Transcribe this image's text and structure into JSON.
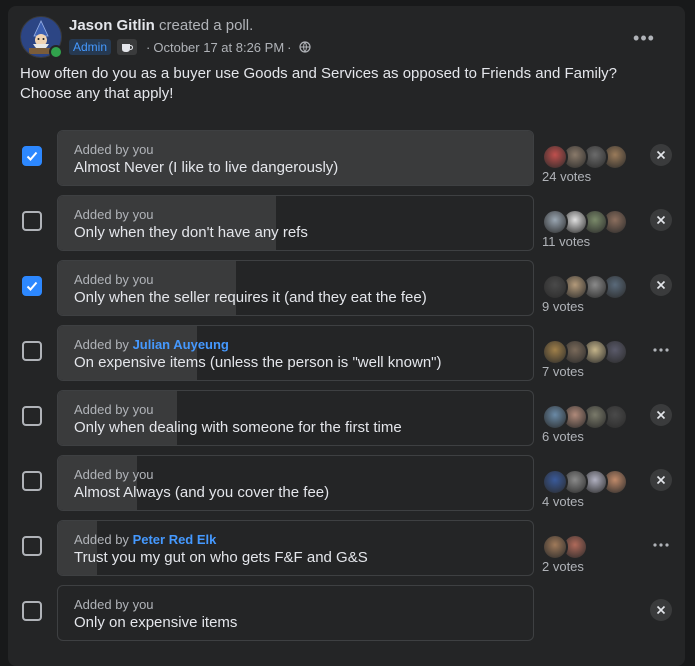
{
  "post": {
    "author": "Jason Gitlin",
    "action": "created a poll.",
    "admin_badge": "Admin",
    "timestamp": "October 17 at 8:26 PM",
    "separator": "·",
    "more_label": "•••",
    "question": "How often do you as a buyer use Goods and Services as opposed to Friends and Family?  Choose any that apply!"
  },
  "colors": {
    "accent": "#2d88ff",
    "link": "#4599ff",
    "card_bg": "#242526",
    "fill": "#3a3b3c"
  },
  "options": [
    {
      "checked": true,
      "added_prefix": "Added by",
      "added_by": "you",
      "text": "Almost Never (I like to live dangerously)",
      "votes": "24 votes",
      "vote_share": 1.0,
      "action": "close-icon",
      "voter_colors": [
        "#c0504d",
        "#8a7a6a",
        "#6b6b6b",
        "#9a7b5a"
      ]
    },
    {
      "checked": false,
      "added_prefix": "Added by",
      "added_by": "you",
      "text": "Only when they don't have any refs",
      "votes": "11 votes",
      "vote_share": 0.458,
      "action": "close-icon",
      "voter_colors": [
        "#9aa6b2",
        "#e0e0e0",
        "#7a8a6a",
        "#8c6f5e"
      ]
    },
    {
      "checked": true,
      "added_prefix": "Added by",
      "added_by": "you",
      "text": "Only when the seller requires it (and they eat the fee)",
      "votes": "9 votes",
      "vote_share": 0.375,
      "action": "close-icon",
      "voter_colors": [
        "#4a4a4a",
        "#b39a7a",
        "#8a8a8a",
        "#5a6a7a"
      ]
    },
    {
      "checked": false,
      "added_prefix": "Added by",
      "added_by": "Julian Auyeung",
      "text": "On expensive items (unless the person is \"well known\")",
      "votes": "7 votes",
      "vote_share": 0.292,
      "action": "more-icon",
      "voter_colors": [
        "#a0804a",
        "#7a6a5a",
        "#c4b48a",
        "#5a5a6a"
      ]
    },
    {
      "checked": false,
      "added_prefix": "Added by",
      "added_by": "you",
      "text": "Only when dealing with someone for the first time",
      "votes": "6 votes",
      "vote_share": 0.25,
      "action": "close-icon",
      "voter_colors": [
        "#6a8aa6",
        "#b08a7a",
        "#7a7a6a",
        "#4a4a4a"
      ]
    },
    {
      "checked": false,
      "added_prefix": "Added by",
      "added_by": "you",
      "text": "Almost Always (and you cover the fee)",
      "votes": "4 votes",
      "vote_share": 0.167,
      "action": "close-icon",
      "voter_colors": [
        "#3a5a9a",
        "#8a8a8a",
        "#b0b0c0",
        "#c08a6a"
      ]
    },
    {
      "checked": false,
      "added_prefix": "Added by",
      "added_by": "Peter Red Elk",
      "text": "Trust you my gut on who gets F&F and G&S",
      "votes": "2 votes",
      "vote_share": 0.083,
      "action": "more-icon",
      "voter_colors": [
        "#a07a5a",
        "#b06a5a"
      ]
    },
    {
      "checked": false,
      "added_prefix": "Added by",
      "added_by": "you",
      "text": "Only on expensive items",
      "votes": "",
      "vote_share": 0.0,
      "action": "close-icon",
      "voter_colors": []
    }
  ]
}
